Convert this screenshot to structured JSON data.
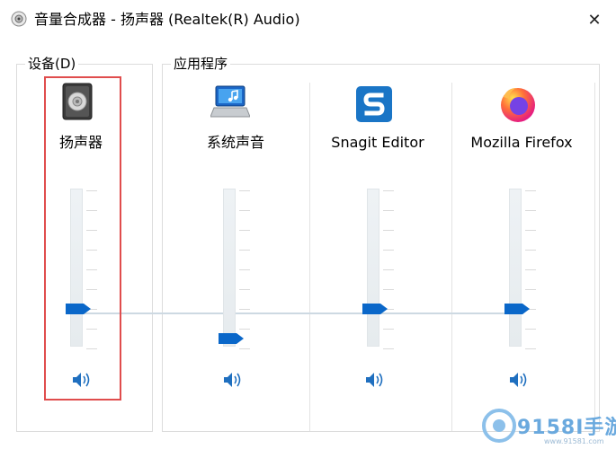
{
  "window": {
    "title": "音量合成器 - 扬声器 (Realtek(R) Audio)",
    "close_glyph": "✕"
  },
  "device_group": {
    "label": "设备(D)",
    "device": {
      "name": "扬声器",
      "icon": "speaker-device-icon",
      "volume_fraction": 0.78,
      "mute_icon": "speaker-volume-icon"
    }
  },
  "apps_group": {
    "label": "应用程序",
    "apps": [
      {
        "name": "系统声音",
        "icon": "system-sounds-icon",
        "volume_fraction": 0.98
      },
      {
        "name": "Snagit Editor",
        "icon": "snagit-icon",
        "volume_fraction": 0.78
      },
      {
        "name": "Mozilla Firefox",
        "icon": "firefox-icon",
        "volume_fraction": 0.78
      }
    ]
  },
  "watermark": {
    "brand": "9158I手游",
    "url": "www.91581.com"
  },
  "colors": {
    "accent": "#0a67c9",
    "highlight": "#e04d4d",
    "snagit": "#1a75c6",
    "firefox_orange": "#ff7139"
  }
}
